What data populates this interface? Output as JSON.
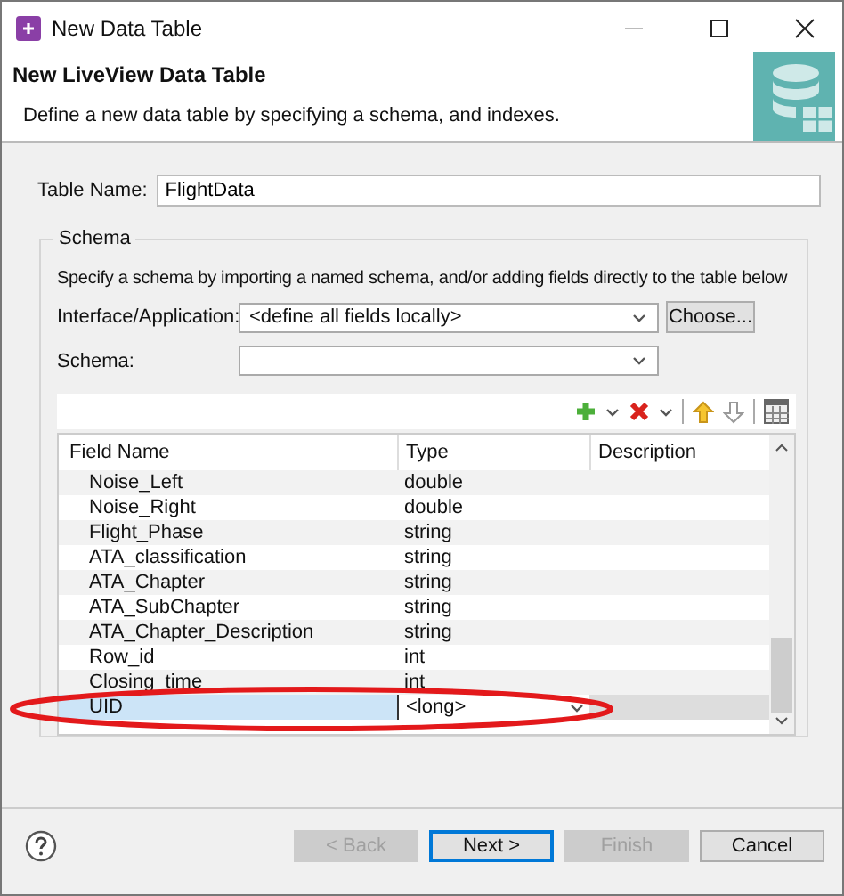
{
  "window": {
    "title": "New Data Table"
  },
  "header": {
    "title": "New LiveView Data Table",
    "description": "Define a new data table by specifying a schema, and indexes."
  },
  "table_name": {
    "label": "Table Name:",
    "value": "FlightData"
  },
  "schema": {
    "title": "Schema",
    "hint": "Specify a schema by importing a named schema, and/or adding fields directly to the table below",
    "interface": {
      "label": "Interface/Application:",
      "value": "<define all fields locally>",
      "button": "Choose..."
    },
    "schema_field": {
      "label": "Schema:"
    },
    "columns": [
      "Field Name",
      "Type",
      "Description"
    ],
    "rows": [
      {
        "name": "Noise_Left",
        "type": "double",
        "selected": false
      },
      {
        "name": "Noise_Right",
        "type": "double",
        "selected": false
      },
      {
        "name": "Flight_Phase",
        "type": "string",
        "selected": false
      },
      {
        "name": "ATA_classification",
        "type": "string",
        "selected": false
      },
      {
        "name": "ATA_Chapter",
        "type": "string",
        "selected": false
      },
      {
        "name": "ATA_SubChapter",
        "type": "string",
        "selected": false
      },
      {
        "name": "ATA_Chapter_Description",
        "type": "string",
        "selected": false
      },
      {
        "name": "Row_id",
        "type": "int",
        "selected": false
      },
      {
        "name": "Closing_time",
        "type": "int",
        "selected": false
      },
      {
        "name": "UID",
        "type": "<long>",
        "selected": true
      }
    ]
  },
  "buttons": [
    {
      "label": "< Back",
      "disabled": true,
      "default": false
    },
    {
      "label": "Next >",
      "disabled": false,
      "default": true
    },
    {
      "label": "Finish",
      "disabled": true,
      "default": false
    },
    {
      "label": "Cancel",
      "disabled": false,
      "default": false
    }
  ]
}
